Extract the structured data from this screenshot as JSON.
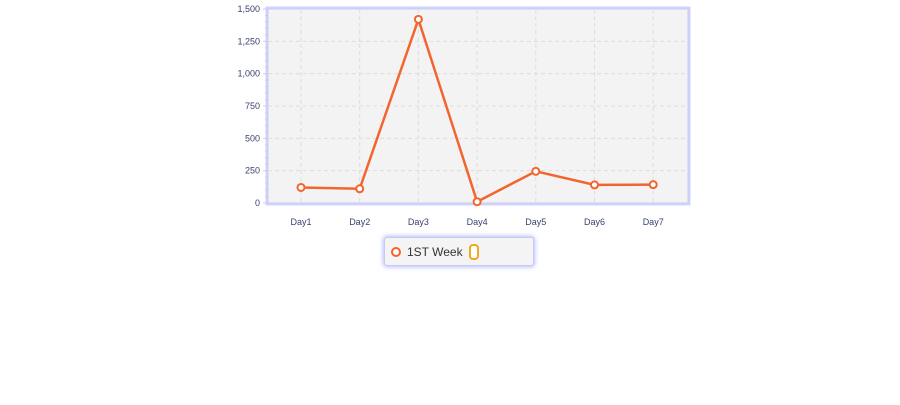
{
  "chart_data": {
    "type": "line",
    "title": "",
    "xlabel": "",
    "ylabel": "",
    "categories": [
      "Day1",
      "Day2",
      "Day3",
      "Day4",
      "Day5",
      "Day6",
      "Day7"
    ],
    "series": [
      {
        "name": "1ST Week",
        "values": [
          120,
          110,
          1420,
          10,
          245,
          140,
          142
        ],
        "color": "#f2652f"
      }
    ],
    "ylim": [
      0,
      1500
    ],
    "yticks": [
      0,
      250,
      500,
      750,
      1000,
      1250,
      1500
    ],
    "ytick_labels": [
      "0",
      "250",
      "500",
      "750",
      "1,000",
      "1,250",
      "1,500"
    ],
    "grid": true,
    "legend_position": "bottom-center",
    "colors": {
      "plot_background": "#f3f3f3",
      "grid": "#dddddd",
      "axis": "#c8ccf2",
      "tick_label": "#3a3f6e",
      "series": "#f2652f",
      "legend_toggle": "#f5a623"
    }
  },
  "legend": {
    "items": [
      {
        "label": "1ST Week",
        "icon": "circle-marker-icon"
      }
    ],
    "toggle_icon": "series-toggle-icon"
  }
}
